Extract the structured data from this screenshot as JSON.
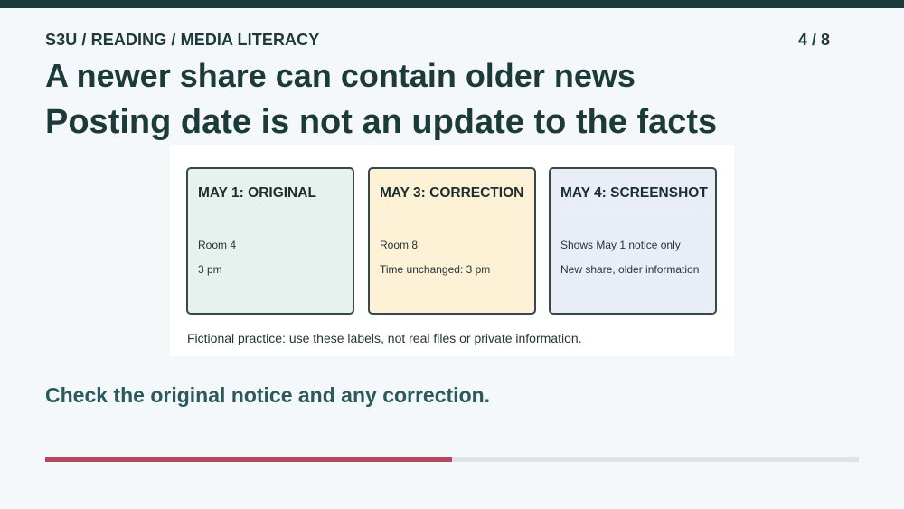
{
  "header": {
    "breadcrumb": "S3U / READING / MEDIA LITERACY",
    "page_count": "4 / 8",
    "title": "A newer share can contain older news",
    "subtitle": "Posting date is not an update to the facts"
  },
  "figure": {
    "cards": [
      {
        "title": "MAY 1: ORIGINAL",
        "lines": [
          "Room 4",
          "3 pm"
        ],
        "fill": "#e7f2ee"
      },
      {
        "title": "MAY 3: CORRECTION",
        "lines": [
          "Room 8",
          "Time unchanged: 3 pm"
        ],
        "fill": "#fdf1d6"
      },
      {
        "title": "MAY 4: SCREENSHOT",
        "lines": [
          "Shows May 1 notice only",
          "New share, older information"
        ],
        "fill": "#e9eef6"
      }
    ],
    "caption": "Fictional practice: use these labels, not real files or private information."
  },
  "tip": "Check the original notice and any correction.",
  "progress": {
    "fraction": 0.5,
    "fill_color": "#b5475e",
    "track_color": "#dde4e7"
  },
  "colors": {
    "top_bar": "#1b3b3a",
    "heading": "#1c3a36",
    "tip": "#2c5a5c"
  }
}
